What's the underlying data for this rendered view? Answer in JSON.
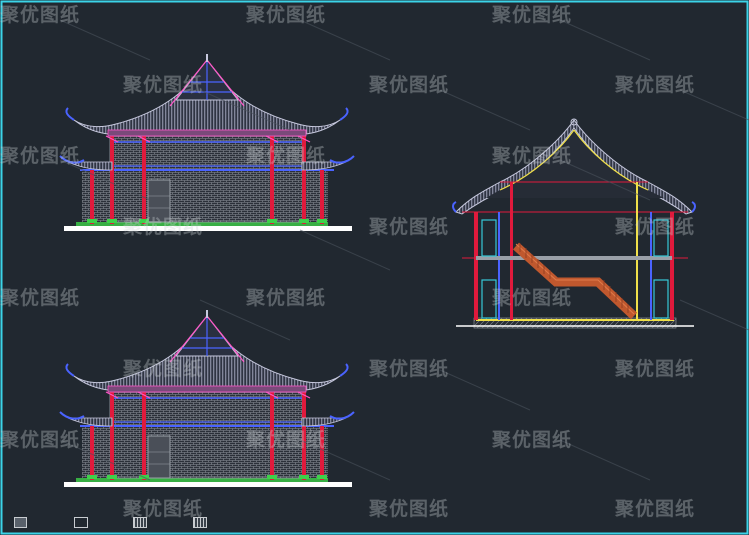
{
  "watermark": {
    "text": "聚优图纸"
  },
  "colors": {
    "background": "#212830",
    "frame": "#3bd4e8",
    "roof": "#b8bcd8",
    "roof_line": "#c7c9de",
    "red": "#e01a3c",
    "blue": "#4a63ff",
    "magenta": "#ff55c8",
    "yellow": "#f0e04a",
    "green": "#3ed14a",
    "cyan": "#36c8d8",
    "brown": "#c0582e",
    "gray": "#9aa0a8"
  },
  "layout_tabs": [
    {
      "name": "tab-1",
      "style": "filled"
    },
    {
      "name": "tab-2",
      "style": "outline"
    },
    {
      "name": "tab-3",
      "style": "hatched"
    },
    {
      "name": "tab-4",
      "style": "hatched"
    }
  ]
}
